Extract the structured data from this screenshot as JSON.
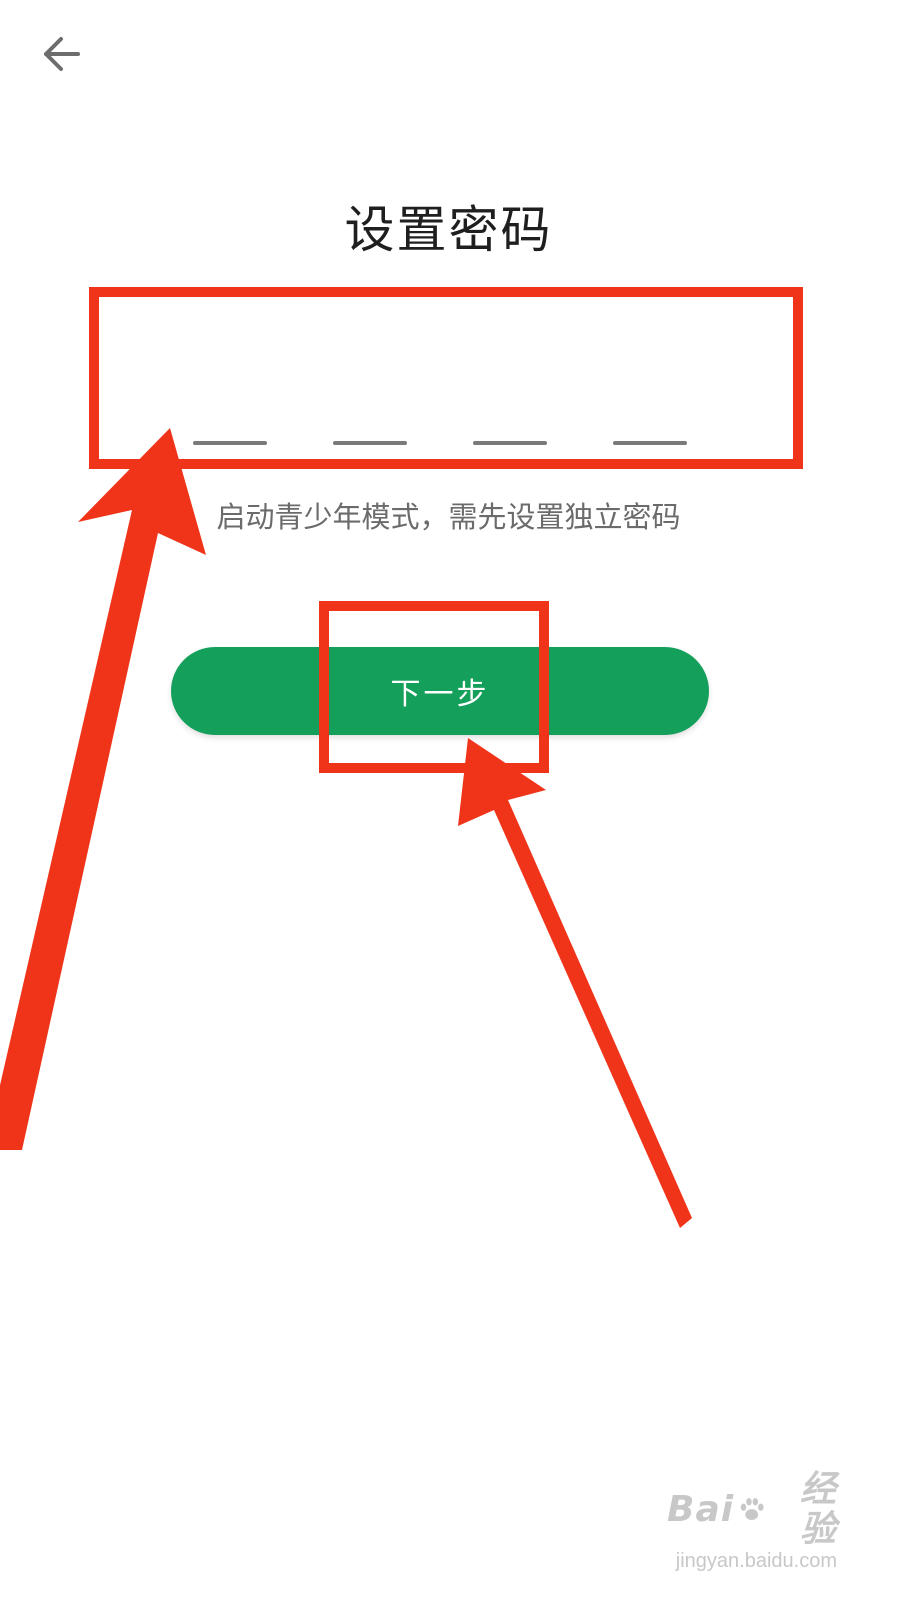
{
  "header": {
    "back_icon": "arrow-left-icon"
  },
  "page": {
    "title": "设置密码",
    "pin_length": 4,
    "hint": "启动青少年模式，需先设置独立密码"
  },
  "actions": {
    "next_label": "下一步"
  },
  "colors": {
    "primary_button": "#14a05a",
    "annotation_red": "#f0341a",
    "pin_slot": "#7a7a7a",
    "title_text": "#1f1f1f",
    "hint_text": "#6b6b6b"
  },
  "watermark": {
    "logo_text_left": "Bai",
    "logo_text_right": "经验",
    "url": "jingyan.baidu.com"
  }
}
